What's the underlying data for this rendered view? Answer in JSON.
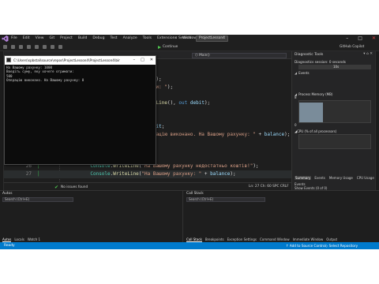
{
  "app": {
    "menu": [
      "File",
      "Edit",
      "View",
      "Git",
      "Project",
      "Build",
      "Debug",
      "Test",
      "Analyze",
      "Tools",
      "Extensions",
      "Window",
      "Help"
    ],
    "search_label": "Search",
    "project_badge": "ProjectLesson4"
  },
  "toolbar": {
    "run_label": "Continue",
    "copilot_label": "GitHub Copilot"
  },
  "editor": {
    "member_dropdown": "Main()",
    "lines": [
      {
        "n": "",
        "mark": false,
        "html": "                 <span class=\"vr\">Encoding</span>.<span class=\"vr\">UTF8</span>;"
      },
      {
        "n": "",
        "mark": false,
        "html": ""
      },
      {
        "n": "",
        "mark": false,
        "html": "               <span class=\"st\">рахунку: \" + balance</span>);"
      },
      {
        "n": "",
        "mark": false,
        "html": "               <span class=\"st\">, яку хочете отримати: \"</span>);"
      },
      {
        "n": "",
        "mark": false,
        "html": ""
      },
      {
        "n": "18",
        "mark": true,
        "html": "        <span class=\"ty\">float</span>.<span class=\"fn\">TryParse</span>(<span class=\"ty\">Console</span>.<span class=\"fn\">ReadLine</span>(), <span class=\"kw\">out</span> <span class=\"vr\">debit</span>);"
      },
      {
        "n": "19",
        "mark": false,
        "html": "        <span class=\"kw\">if</span>(<span class=\"vr\">balance</span> &gt;= <span class=\"vr\">debit</span>)"
      },
      {
        "n": "20",
        "mark": false,
        "html": "        {"
      },
      {
        "n": "21",
        "mark": false,
        "html": "            <span class=\"vr\">balance</span> = <span class=\"vr\">balance</span> - <span class=\"vr\">debit</span>;"
      },
      {
        "n": "22",
        "mark": true,
        "html": "            <span class=\"ty\">Console</span>.<span class=\"fn\">WriteLine</span>(<span class=\"st\">\"Операцію виконано. На Вашому рахунку: \"</span> + <span class=\"vr\">balance</span>);"
      },
      {
        "n": "23",
        "mark": false,
        "html": "        }"
      },
      {
        "n": "24",
        "mark": false,
        "html": "        <span class=\"kw\">else</span>"
      },
      {
        "n": "25",
        "mark": false,
        "html": "        {"
      },
      {
        "n": "26",
        "mark": true,
        "html": "            <span class=\"ty\">Console</span>.<span class=\"fn\">WriteLine</span>(<span class=\"st\">\"На Вашому рахунку недостатньо коштів!\"</span>);"
      },
      {
        "n": "27",
        "mark": true,
        "html": "            <span class=\"ty\">Console</span>.<span class=\"fn\">WriteLine</span>(<span class=\"st\">\"На Вашому рахунку: \"</span> + <span class=\"vr\">balance</span>);",
        "current": true
      }
    ],
    "issues_text": "No issues found",
    "cursor_text": "Ln: 27   Ch: 60   SPC   CRLF"
  },
  "console": {
    "title": "C:\\Users\\spbstal\\source\\repos\\ProjectLesson4\\ProjectLesson4\\bin\\Debug\\ProjectLe...",
    "lines": [
      "На Вашому рахунку: 1000",
      "Введіть суму, яку хочете отримати:",
      "500",
      "Операцію виконано. На Вашому рахунку: 0"
    ]
  },
  "diagnostics": {
    "title": "Diagnostic Tools",
    "session": "Diagnostics session: 0 seconds",
    "timeline_label": "10s",
    "events_label": "Events",
    "memory_label": "Process Memory (MB)",
    "mem_top": "8",
    "mem_bottom": "0",
    "cpu_label": "CPU (% of all processors)",
    "tabs": [
      "Summary",
      "Events",
      "Memory Usage",
      "CPU Usage"
    ],
    "events_section": "Events",
    "show_events": "Show Events (0 of 0)"
  },
  "bottom": {
    "autos_title": "Autos",
    "callstack_title": "Call Stack",
    "search_placeholder": "Search (Ctrl+E)",
    "autos_tabs": [
      "Autos",
      "Locals",
      "Watch 1"
    ],
    "callstack_tabs": [
      "Call Stack",
      "Breakpoints",
      "Exception Settings",
      "Command Window",
      "Immediate Window",
      "Output"
    ]
  },
  "status": {
    "ready": "Ready",
    "source_control": "Add to Source Control",
    "select_repo": "Select Repository"
  }
}
